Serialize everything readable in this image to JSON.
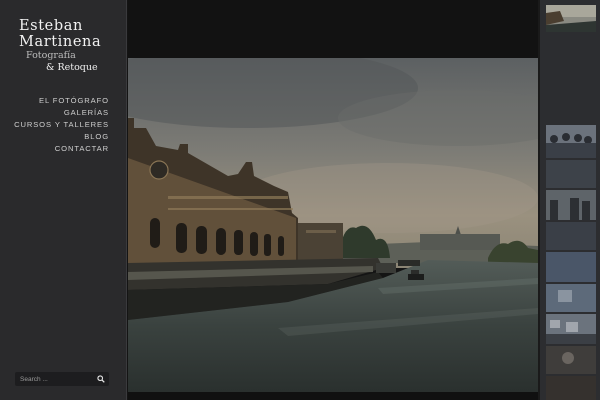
{
  "brand": {
    "line1": "Esteban",
    "line2": "Martinena",
    "sub1": "Fotografía",
    "sub2": "& Retoque"
  },
  "nav": {
    "items": [
      {
        "label": "EL FOTÓGRAFO"
      },
      {
        "label": "GALERÍAS"
      },
      {
        "label": "CURSOS Y TALLERES"
      },
      {
        "label": "BLOG"
      },
      {
        "label": "CONTACTAR"
      }
    ]
  },
  "search": {
    "placeholder": "Search ...",
    "icon": "search-icon"
  },
  "colors": {
    "sidebar_bg": "#2a2a2c",
    "page_bg": "#141414",
    "nav_text": "#cfcfcf"
  }
}
